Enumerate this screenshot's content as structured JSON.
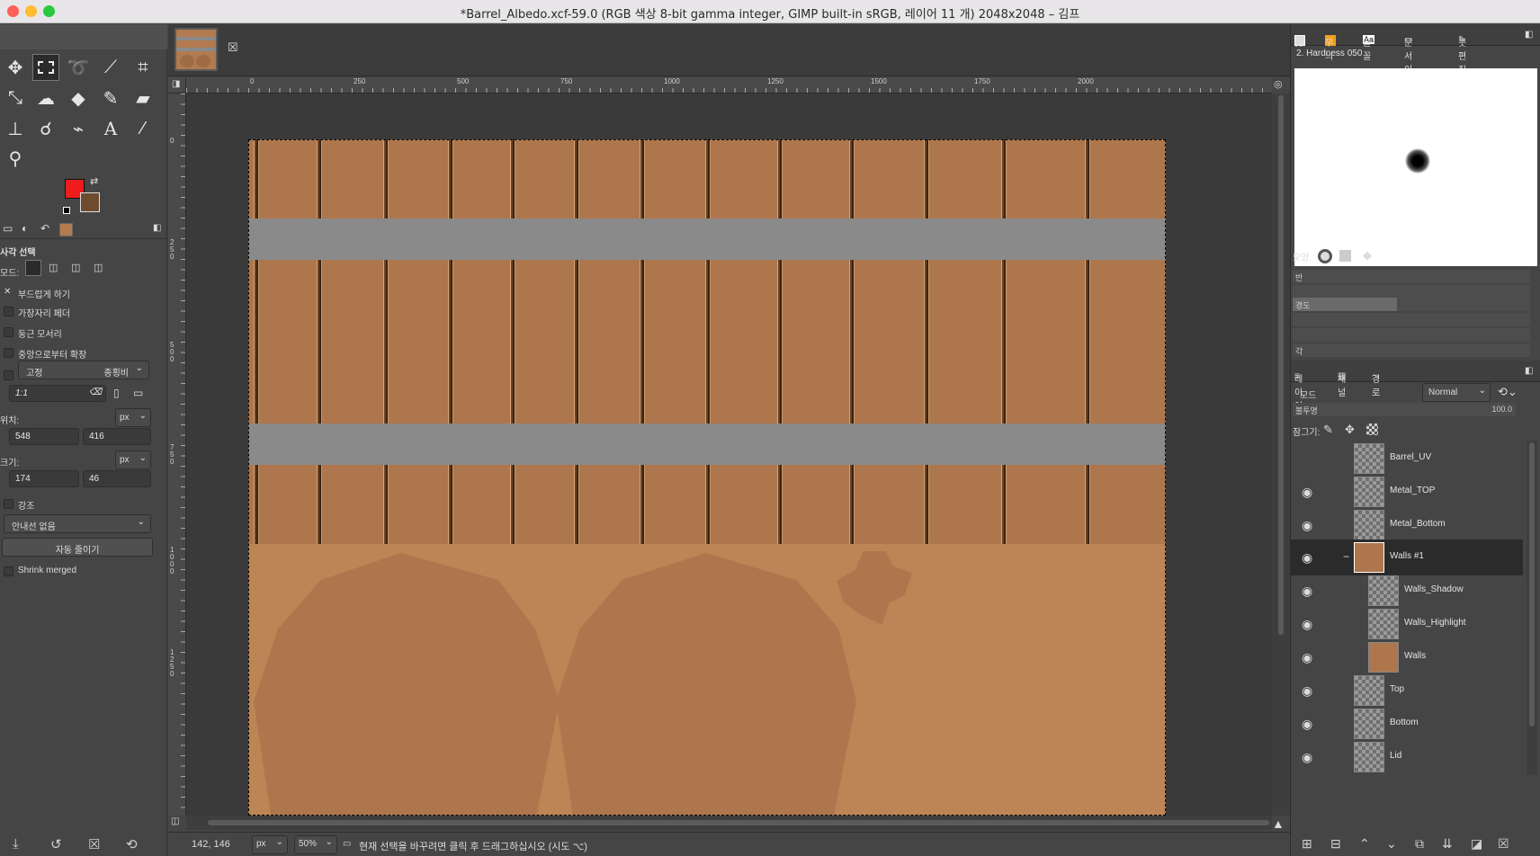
{
  "window": {
    "title": "*Barrel_Albedo.xcf-59.0 (RGB 색상 8-bit gamma integer, GIMP built-in sRGB, 레이어 11 개) 2048x2048 – 김프"
  },
  "colors": {
    "foreground": "#ee1c1c",
    "background": "#6e4b2e",
    "wood": "#ad764c",
    "wood_light": "#bd8555",
    "metal": "#8a8a8a"
  },
  "toolbox": {
    "tools": [
      "move-icon",
      "rect-select-icon",
      "lasso-icon",
      "fuzzy-select-icon",
      "crop-icon",
      "transform-icon",
      "warp-icon",
      "bucket-fill-icon",
      "paintbrush-icon",
      "eraser-icon",
      "clone-icon",
      "smudge-icon",
      "paths-icon",
      "text-icon",
      "color-picker-icon",
      "zoom-icon"
    ],
    "tool_text_glyph": "A"
  },
  "tool_options": {
    "title": "사각 선택",
    "mode_label": "모드:",
    "antialias": "부드럽게 하기",
    "feather": "가장자리 페더",
    "rounded": "둥근 모서리",
    "expand_center": "중앙으로부터 확장",
    "fixed": "고정",
    "fixed_mode": "종횡비",
    "ratio_value": "1:1",
    "position_label": "위치:",
    "position_unit": "px",
    "pos_x": "548",
    "pos_y": "416",
    "size_label": "크기:",
    "size_unit": "px",
    "size_w": "174",
    "size_h": "46",
    "highlight": "강조",
    "guides": "안내선 없음",
    "auto_shrink": "자동 줄이기",
    "shrink_merged": "Shrink merged"
  },
  "ruler": {
    "h_labels": [
      "0",
      "250",
      "500",
      "750",
      "1000",
      "1250",
      "1500",
      "1750",
      "2000"
    ],
    "v_labels": [
      "0",
      "250",
      "500",
      "750",
      "1000",
      "1250"
    ]
  },
  "status": {
    "coords": "142, 146",
    "unit": "px",
    "zoom": "50%",
    "message": "현재 선택을 바꾸려면 클릭 후 드래그하십시오 (시도 ⌥)"
  },
  "brushes": {
    "tabs": [
      "붓",
      "무늬",
      "글꼴",
      "문서 이력",
      "붓 편집기"
    ],
    "tab_font_glyph": "Aa",
    "brush_name": "2. Hardness 050",
    "shape_label": "모양:",
    "hardness_label": "경도",
    "radius_label": "반",
    "angle_label": "각"
  },
  "layers": {
    "tabs": [
      "레이어",
      "채널",
      "경로"
    ],
    "mode_label": "모드",
    "mode_value": "Normal",
    "opacity_label": "불투명",
    "opacity_value": "100.0",
    "lock_label": "잠그기:",
    "items": [
      {
        "name": "Barrel_UV",
        "visible": false,
        "indent": 0,
        "thumb": "check"
      },
      {
        "name": "Metal_TOP",
        "visible": true,
        "indent": 0,
        "thumb": "check"
      },
      {
        "name": "Metal_Bottom",
        "visible": true,
        "indent": 0,
        "thumb": "check"
      },
      {
        "name": "Walls #1",
        "visible": true,
        "indent": 0,
        "thumb": "wood",
        "selected": true,
        "group": true
      },
      {
        "name": "Walls_Shadow",
        "visible": true,
        "indent": 1,
        "thumb": "check"
      },
      {
        "name": "Walls_Highlight",
        "visible": true,
        "indent": 1,
        "thumb": "check"
      },
      {
        "name": "Walls",
        "visible": true,
        "indent": 1,
        "thumb": "wood"
      },
      {
        "name": "Top",
        "visible": true,
        "indent": 0,
        "thumb": "check"
      },
      {
        "name": "Bottom",
        "visible": true,
        "indent": 0,
        "thumb": "check"
      },
      {
        "name": "Lid",
        "visible": true,
        "indent": 0,
        "thumb": "check"
      }
    ]
  }
}
